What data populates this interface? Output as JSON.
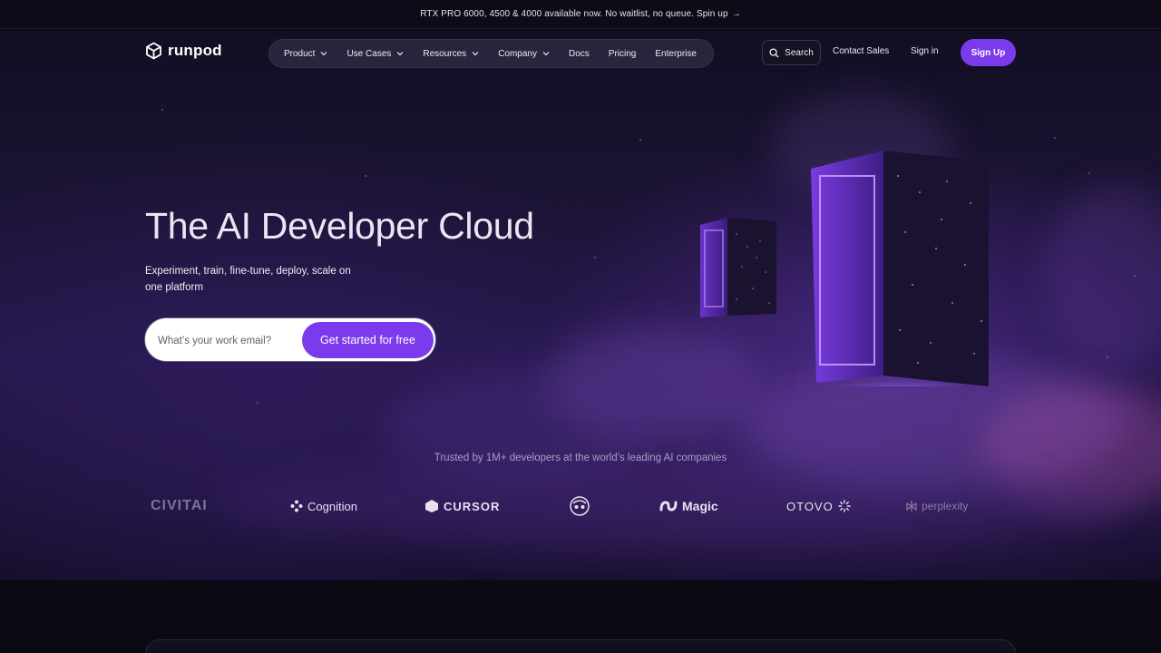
{
  "announcement": {
    "text": "RTX PRO 6000, 4500 & 4000 available now. No waitlist, no queue. Spin up",
    "arrow": "→"
  },
  "nav": {
    "logo_text": "runpod",
    "items": [
      {
        "label": "Product",
        "has_dropdown": true
      },
      {
        "label": "Use Cases",
        "has_dropdown": true
      },
      {
        "label": "Resources",
        "has_dropdown": true
      },
      {
        "label": "Company",
        "has_dropdown": true
      },
      {
        "label": "Docs",
        "has_dropdown": false
      },
      {
        "label": "Pricing",
        "has_dropdown": false
      },
      {
        "label": "Enterprise",
        "has_dropdown": false
      }
    ],
    "search_label": "Search",
    "contact_label": "Contact Sales",
    "signin_label": "Sign in",
    "signup_label": "Sign Up"
  },
  "hero": {
    "title": "The AI Developer Cloud",
    "subtitle": "Experiment, train, fine-tune, deploy, scale on one platform",
    "email_placeholder": "What’s your work email?",
    "cta_label": "Get started for free"
  },
  "trusted": {
    "text": "Trusted by 1M+ developers at the world’s leading AI companies",
    "logos": [
      {
        "name": "CIVITAI",
        "icon": "civitai-logo"
      },
      {
        "name": "Cognition",
        "icon": "cognition-logo"
      },
      {
        "name": "CURSOR",
        "icon": "cursor-logo"
      },
      {
        "name": "",
        "icon": "mascot-logo"
      },
      {
        "name": "Magic",
        "icon": "magic-logo"
      },
      {
        "name": "OTOVO",
        "icon": "otovo-logo"
      },
      {
        "name": "perplexity",
        "icon": "perplexity-logo"
      }
    ]
  },
  "colors": {
    "accent": "#7c3aed",
    "background": "#0b0914"
  }
}
